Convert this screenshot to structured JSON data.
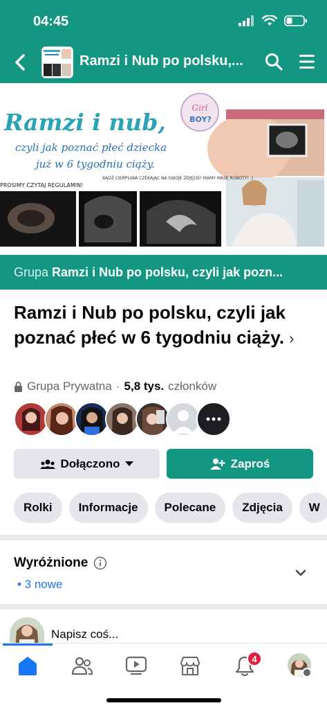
{
  "status": {
    "time": "04:45"
  },
  "nav": {
    "title": "Ramzi i Nub po polsku,..."
  },
  "cover": {
    "headline": "Ramzi i nub,",
    "subline1": "czyli jak poznać płeć dziecka",
    "subline2": "już w 6 tygodniu ciąży.",
    "note_left": "PROSIMY CZYTAJ REGULAMIN!",
    "note_right": "BĄDŹ CIERPLIWA CZEKAJĄC NA SWOJE ZDJĘCIE! MAMY MASĘ ROBOTY! ;)",
    "badge_top": "Girl",
    "badge_bottom": "BOY?"
  },
  "strip": {
    "prefix": "Grupa",
    "name": "Ramzi i Nub po polsku, czyli jak pozn..."
  },
  "group": {
    "title": "Ramzi i Nub po polsku, czyli jak poznać płeć w 6 tygodniu ciąży.",
    "privacy": "Grupa Prywatna",
    "dot": "·",
    "members_count": "5,8 tys.",
    "members_label": "członków"
  },
  "actions": {
    "joined": "Dołączono",
    "invite": "Zaproś"
  },
  "tabs": [
    "Rolki",
    "Informacje",
    "Polecane",
    "Zdjęcia",
    "W"
  ],
  "featured": {
    "title": "Wyróżnione",
    "new": "• 3 nowe"
  },
  "composer": {
    "placeholder": "Napisz coś..."
  },
  "notifications": {
    "badge": "4"
  },
  "colors": {
    "brand": "#139783",
    "link": "#1877f2",
    "badge": "#e41e3f"
  },
  "icons": [
    "back-icon",
    "search-icon",
    "menu-icon",
    "lock-icon",
    "more-icon",
    "people-icon",
    "caret-down-icon",
    "add-person-icon",
    "info-icon",
    "chevron-down-icon",
    "home-icon",
    "friends-icon",
    "video-icon",
    "marketplace-icon",
    "bell-icon"
  ]
}
